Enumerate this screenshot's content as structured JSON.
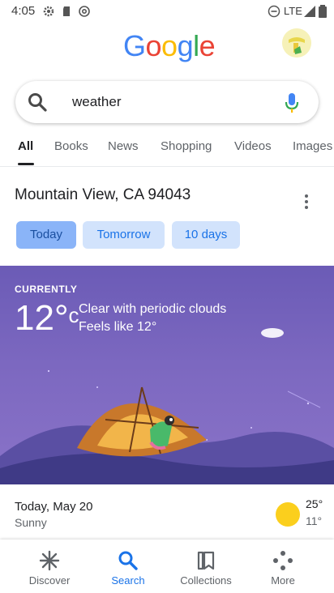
{
  "status_bar": {
    "time": "4:05",
    "network": "LTE"
  },
  "logo": {
    "letters": [
      "G",
      "o",
      "o",
      "g",
      "l",
      "e"
    ],
    "colors": [
      "#4285F4",
      "#EA4335",
      "#FBBC05",
      "#4285F4",
      "#34A853",
      "#EA4335"
    ]
  },
  "search": {
    "query": "weather"
  },
  "tabs": [
    {
      "label": "All",
      "active": true
    },
    {
      "label": "Books"
    },
    {
      "label": "News"
    },
    {
      "label": "Shopping"
    },
    {
      "label": "Videos"
    },
    {
      "label": "Images"
    }
  ],
  "weather": {
    "location": "Mountain View, CA 94043",
    "day_chips": [
      "Today",
      "Tomorrow",
      "10 days"
    ],
    "currently_label": "CURRENTLY",
    "temperature": "12°",
    "unit": "c",
    "condition": "Clear with periodic clouds",
    "feels_like": "Feels like 12°",
    "forecast": {
      "day": "Today, May 20",
      "condition": "Sunny",
      "high": "25°",
      "low": "11°"
    }
  },
  "bottom_nav": [
    {
      "label": "Discover",
      "icon": "asterisk-icon"
    },
    {
      "label": "Search",
      "icon": "search-icon",
      "active": true
    },
    {
      "label": "Collections",
      "icon": "collections-icon"
    },
    {
      "label": "More",
      "icon": "more-dots-icon"
    }
  ],
  "colors": {
    "accent": "#1a73e8",
    "sky": "#7c68c0",
    "sun": "#fbcf1d"
  }
}
